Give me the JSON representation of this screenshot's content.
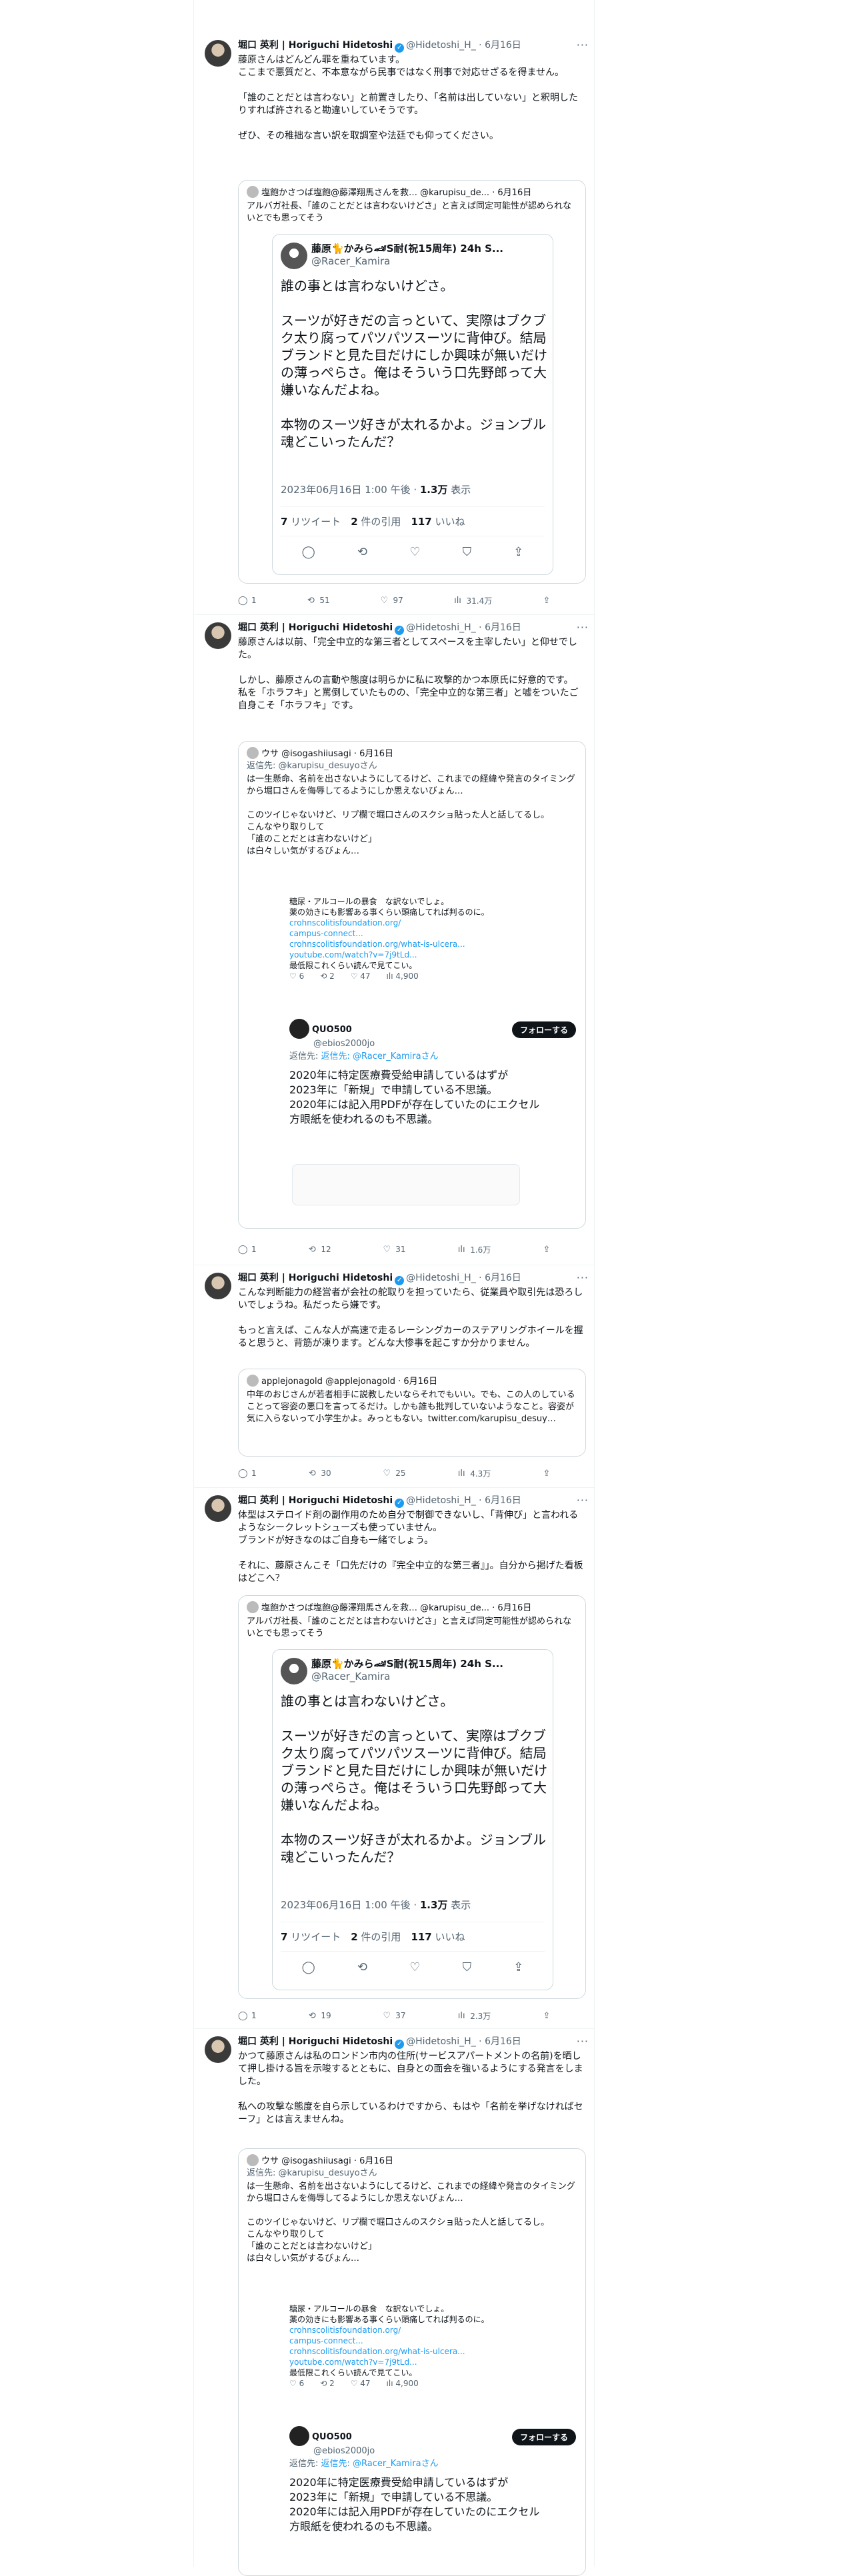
{
  "author": {
    "name": "堀口 英利 | Horiguchi Hidetoshi",
    "handle": "@Hidetoshi_H_",
    "date": "· 6月16日"
  },
  "tweets": [
    {
      "text": "藤原さんはどんどん罪を重ねています。\nここまで悪質だと、不本意ながら民事ではなく刑事で対応せざるを得ません。\n\n「誰のことだとは言わない」と前置きしたり、「名前は出していない」と釈明したりすれば許されると勘違いしていそうです。\n\nぜひ、その稚拙な言い訳を取調室や法廷でも仰ってください。",
      "quote_header": "塩飽かさつば塩飽@藤澤翔馬さんを救… @karupisu_de... · 6月16日",
      "quote_text": "アルバガ社長、「誰のことだとは言わないけどさ」と言えば同定可能性が認められないとでも思ってそう",
      "stats": {
        "reply": "1",
        "retweet": "51",
        "like": "97",
        "views": "31.4万"
      }
    },
    {
      "text": "藤原さんは以前、「完全中立的な第三者としてスペースを主宰したい」と仰せでした。\n\nしかし、藤原さんの言動や態度は明らかに私に攻撃的かつ本原氏に好意的です。\n私を「ホラフキ」と罵倒していたものの、「完全中立的な第三者」と嘘をついたご自身こそ「ホラフキ」です。",
      "stats": {
        "reply": "1",
        "retweet": "12",
        "like": "31",
        "views": "1.6万"
      }
    },
    {
      "text": "こんな判断能力の経営者が会社の舵取りを担っていたら、従業員や取引先は恐ろしいでしょうね。私だったら嫌です。\n\nもっと言えば、こんな人が高速で走るレーシングカーのステアリングホイールを握ると思うと、背筋が凍ります。どんな大惨事を起こすか分かりません。",
      "quote_header": "applejonagold @applejonagold · 6月16日",
      "quote_text": "中年のおじさんが若者相手に説教したいならそれでもいい。でも、この人のしていることって容姿の悪口を言ってるだけ。しかも誰も批判していないようなこと。容姿が気に入らないって小学生かよ。みっともない。twitter.com/karupisu_desuy…",
      "stats": {
        "reply": "1",
        "retweet": "30",
        "like": "25",
        "views": "4.3万"
      }
    },
    {
      "text": "体型はステロイド剤の副作用のため自分で制御できないし、「背伸び」と言われるようなシークレットシューズも使っていません。\nブランドが好きなのはご自身も一緒でしょう。\n\nそれに、藤原さんこそ「口先だけの『完全中立的な第三者』」。自分から掲げた看板はどこへ？",
      "quote_header": "塩飽かさつば塩飽@藤澤翔馬さんを救… @karupisu_de... · 6月16日",
      "quote_text": "アルバガ社長、「誰のことだとは言わないけどさ」と言えば同定可能性が認められないとでも思ってそう",
      "stats": {
        "reply": "1",
        "retweet": "19",
        "like": "37",
        "views": "2.3万"
      }
    },
    {
      "text": "かつて藤原さんは私のロンドン市内の住所(サービスアパートメントの名前)を晒して押し掛ける旨を示唆するとともに、自身との面会を強いるようにする発言をしました。\n\n私への攻撃な態度を自ら示しているわけですから、もはや「名前を挙げなければセーフ」とは言えませんね。"
    }
  ],
  "racer": {
    "name": "藤原🐈かみら🏎S耐(祝15周年) 24h S...",
    "handle": "@Racer_Kamira",
    "text": "誰の事とは言わないけどさ。\n\nスーツが好きだの言っといて、実際はブクブク太り腐ってパツパツスーツに背伸び。結局ブランドと見た目だけにしか興味が無いだけの薄っぺらさ。俺はそういう口先野郎って大嫌いなんだよね。\n\n本物のスーツ好きが太れるかよ。ジョンブル魂どこいったんだ？",
    "time": "2023年06月16日 1:00 午後 · ",
    "views": "1.3万",
    "views_label": " 表示",
    "rt": "7",
    "rt_label": " リツイート　",
    "quotes": "2",
    "quotes_label": " 件の引用　",
    "likes": "117",
    "likes_label": " いいね"
  },
  "usa": {
    "header": "ウサ @isogashiiusagi · 6月16日",
    "replying": "返信先: @karupisu_desuyoさん",
    "text": "は一生懸命、名前を出さないようにしてるけど、これまでの経緯や発言のタイミングから堀口さんを侮辱してるようにしか思えないびょん…\n\nこのツイじゃないけど、リプ欄で堀口さんのスクショ貼った人と話してるし。\nこんなやり取りして\n「誰のことだとは言わないけど」\nは白々しい気がするびょん…",
    "nested_text": "糖尿・アルコールの暴食　な訳ないでしょ。\n薬の効きにも影響ある事くらい頭痛してれば判るのに。",
    "links": [
      "crohnscolitisfoundation.org/",
      "campus-connect...",
      "crohnscolitisfoundation.org/what-is-ulcera...",
      "youtube.com/watch?v=7j9tLd..."
    ],
    "nested_end": "最低限これくらい読んで見てこい。",
    "nested_stats": "♡ 6　　⟲ 2　　♡ 47　　ılı 4,900",
    "quo_name": "QUO500",
    "quo_handle": "@ebios2000jo",
    "follow": "フォローする",
    "quo_reply": "返信先: @Racer_Kamiraさん",
    "quo_text": "2020年に特定医療費受給申請しているはずが\n2023年に「新規」で申請している不思議。\n2020年には記入用PDFが存在していたのにエクセル方眼紙を使われるのも不思議。"
  }
}
